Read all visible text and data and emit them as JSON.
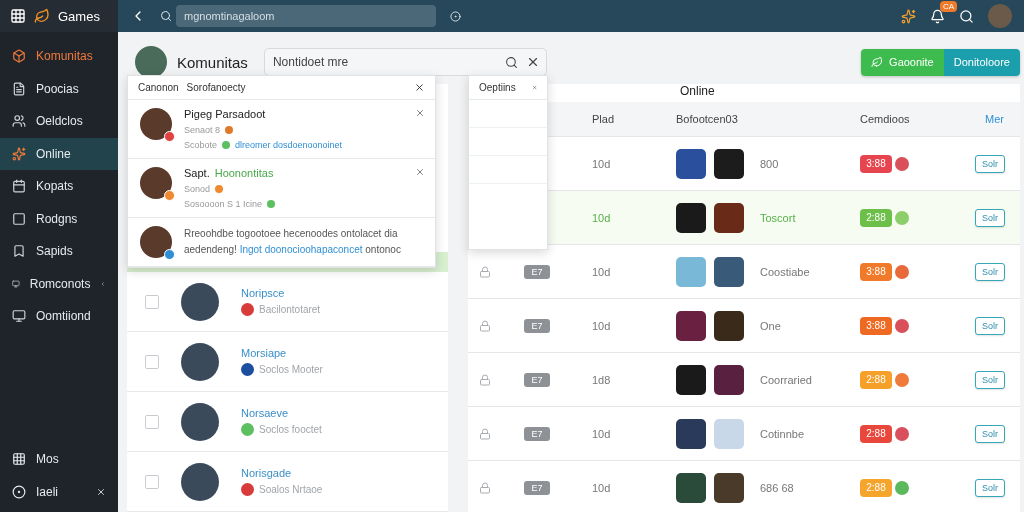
{
  "brand": {
    "title": "Games"
  },
  "sidebar": {
    "items": [
      {
        "label": "Komunitas",
        "kind": "section",
        "selected": false
      },
      {
        "label": "Poocias",
        "kind": "item",
        "selected": false
      },
      {
        "label": "Oeldclos",
        "kind": "item",
        "selected": false
      },
      {
        "label": "Online",
        "kind": "item",
        "selected": true
      },
      {
        "label": "Kopats",
        "kind": "item",
        "selected": false
      },
      {
        "label": "Rodgns",
        "kind": "item",
        "selected": false
      },
      {
        "label": "Sapids",
        "kind": "item",
        "selected": false
      },
      {
        "label": "Romconots",
        "kind": "expandable",
        "selected": false
      },
      {
        "label": "Oomtiiond",
        "kind": "item",
        "selected": false
      }
    ],
    "footer": [
      {
        "label": "Mos",
        "kind": "item"
      },
      {
        "label": "Iaeli",
        "kind": "expandable"
      }
    ]
  },
  "topbar": {
    "search": {
      "placeholder": "mgnomtinagaloom"
    },
    "notification_badge": "CA"
  },
  "header": {
    "title": "Komunitas",
    "search": {
      "value": "Nontidoet mre"
    },
    "buttons": [
      {
        "label": "Gaoonite",
        "kind": "primary"
      },
      {
        "label": "Donitoloore",
        "kind": "secondary"
      }
    ]
  },
  "notifications": {
    "tabs": [
      "Canonon",
      "Sorofanoecty"
    ],
    "items": [
      {
        "kind": "status",
        "title": "Pigeg Parsadoot",
        "meta": "Senaot 8",
        "meta_dot": {
          "color": "#e07a2a"
        },
        "detail": "Scobote",
        "link": "dlreomer dosdoenoonoinet",
        "badge": {
          "color": "#e04040"
        }
      },
      {
        "kind": "status",
        "title": "Sapt.",
        "highlight": "Hoonontitas",
        "meta": "Sonod",
        "meta_dot": {
          "color": "#ef8a30"
        },
        "detail": "Sosoooon S 1 Icine",
        "badge": {
          "color": "#ef8a31"
        }
      },
      {
        "kind": "message",
        "text": "Rreoohdbe togootoee hecenoodes ontolacet dia aedendeng!",
        "link": "Ingot doonocioohapaconcet",
        "tail": "ontonoc",
        "badge": {
          "color": "#2f8fd6"
        }
      }
    ]
  },
  "options": {
    "title": "Oeptiins"
  },
  "members": [
    {
      "name": "Noripsce",
      "sub": "Bacilontotaret",
      "color": "#d93a3a",
      "checked": false
    },
    {
      "name": "Morsiape",
      "sub": "Soclos Mooter",
      "color": "#1c4fa0",
      "checked": false
    },
    {
      "name": "Norsaeve",
      "sub": "Soclos fooctet",
      "color": "#5cc060",
      "checked": false
    },
    {
      "name": "Norisgade",
      "sub": "Soalos Nrtaoe",
      "color": "#d93a3b",
      "checked": false
    }
  ],
  "table": {
    "title": "Online",
    "columns": [
      "Plad",
      "Bofootcen03",
      "Cemdioos",
      "Mer"
    ],
    "rows": [
      {
        "plad": "10d",
        "status": "800",
        "score": "3:88",
        "color": "#e6454f",
        "info": {
          "color": "#d9505a"
        },
        "action": "Solr",
        "selected": false
      },
      {
        "plad": "10d",
        "status": "Toscort",
        "score": "2:88",
        "color": "#6cc04a",
        "info": {
          "color": "#8ccf6a"
        },
        "action": "Solr",
        "selected": true
      },
      {
        "tag": "E7",
        "plad": "10d",
        "status": "Coostiabe",
        "score": "3:88",
        "color": "#f07a2a",
        "info": {
          "color": "#e86a3a"
        },
        "action": "Solr",
        "selected": false
      },
      {
        "tag": "E7",
        "plad": "10d",
        "status": "One",
        "score": "3:88",
        "color": "#ee6a22",
        "info": {
          "color": "#d9505b"
        },
        "action": "Solr",
        "selected": false
      },
      {
        "tag": "E7",
        "plad": "1d8",
        "status": "Coorraried",
        "score": "2:88",
        "color": "#f6a02a",
        "info": {
          "color": "#f07a3a"
        },
        "action": "Solr",
        "selected": false
      },
      {
        "tag": "E7",
        "plad": "10d",
        "status": "Cotinnbe",
        "score": "2:88",
        "color": "#e8483c",
        "info": {
          "color": "#d9505c"
        },
        "action": "Solr",
        "selected": false
      },
      {
        "tag": "E7",
        "plad": "10d",
        "status": "686 68",
        "score": "2:88",
        "color": "#f5a42c",
        "info": {
          "color": "#5cb85c"
        },
        "action": "Solr",
        "selected": false
      }
    ]
  }
}
